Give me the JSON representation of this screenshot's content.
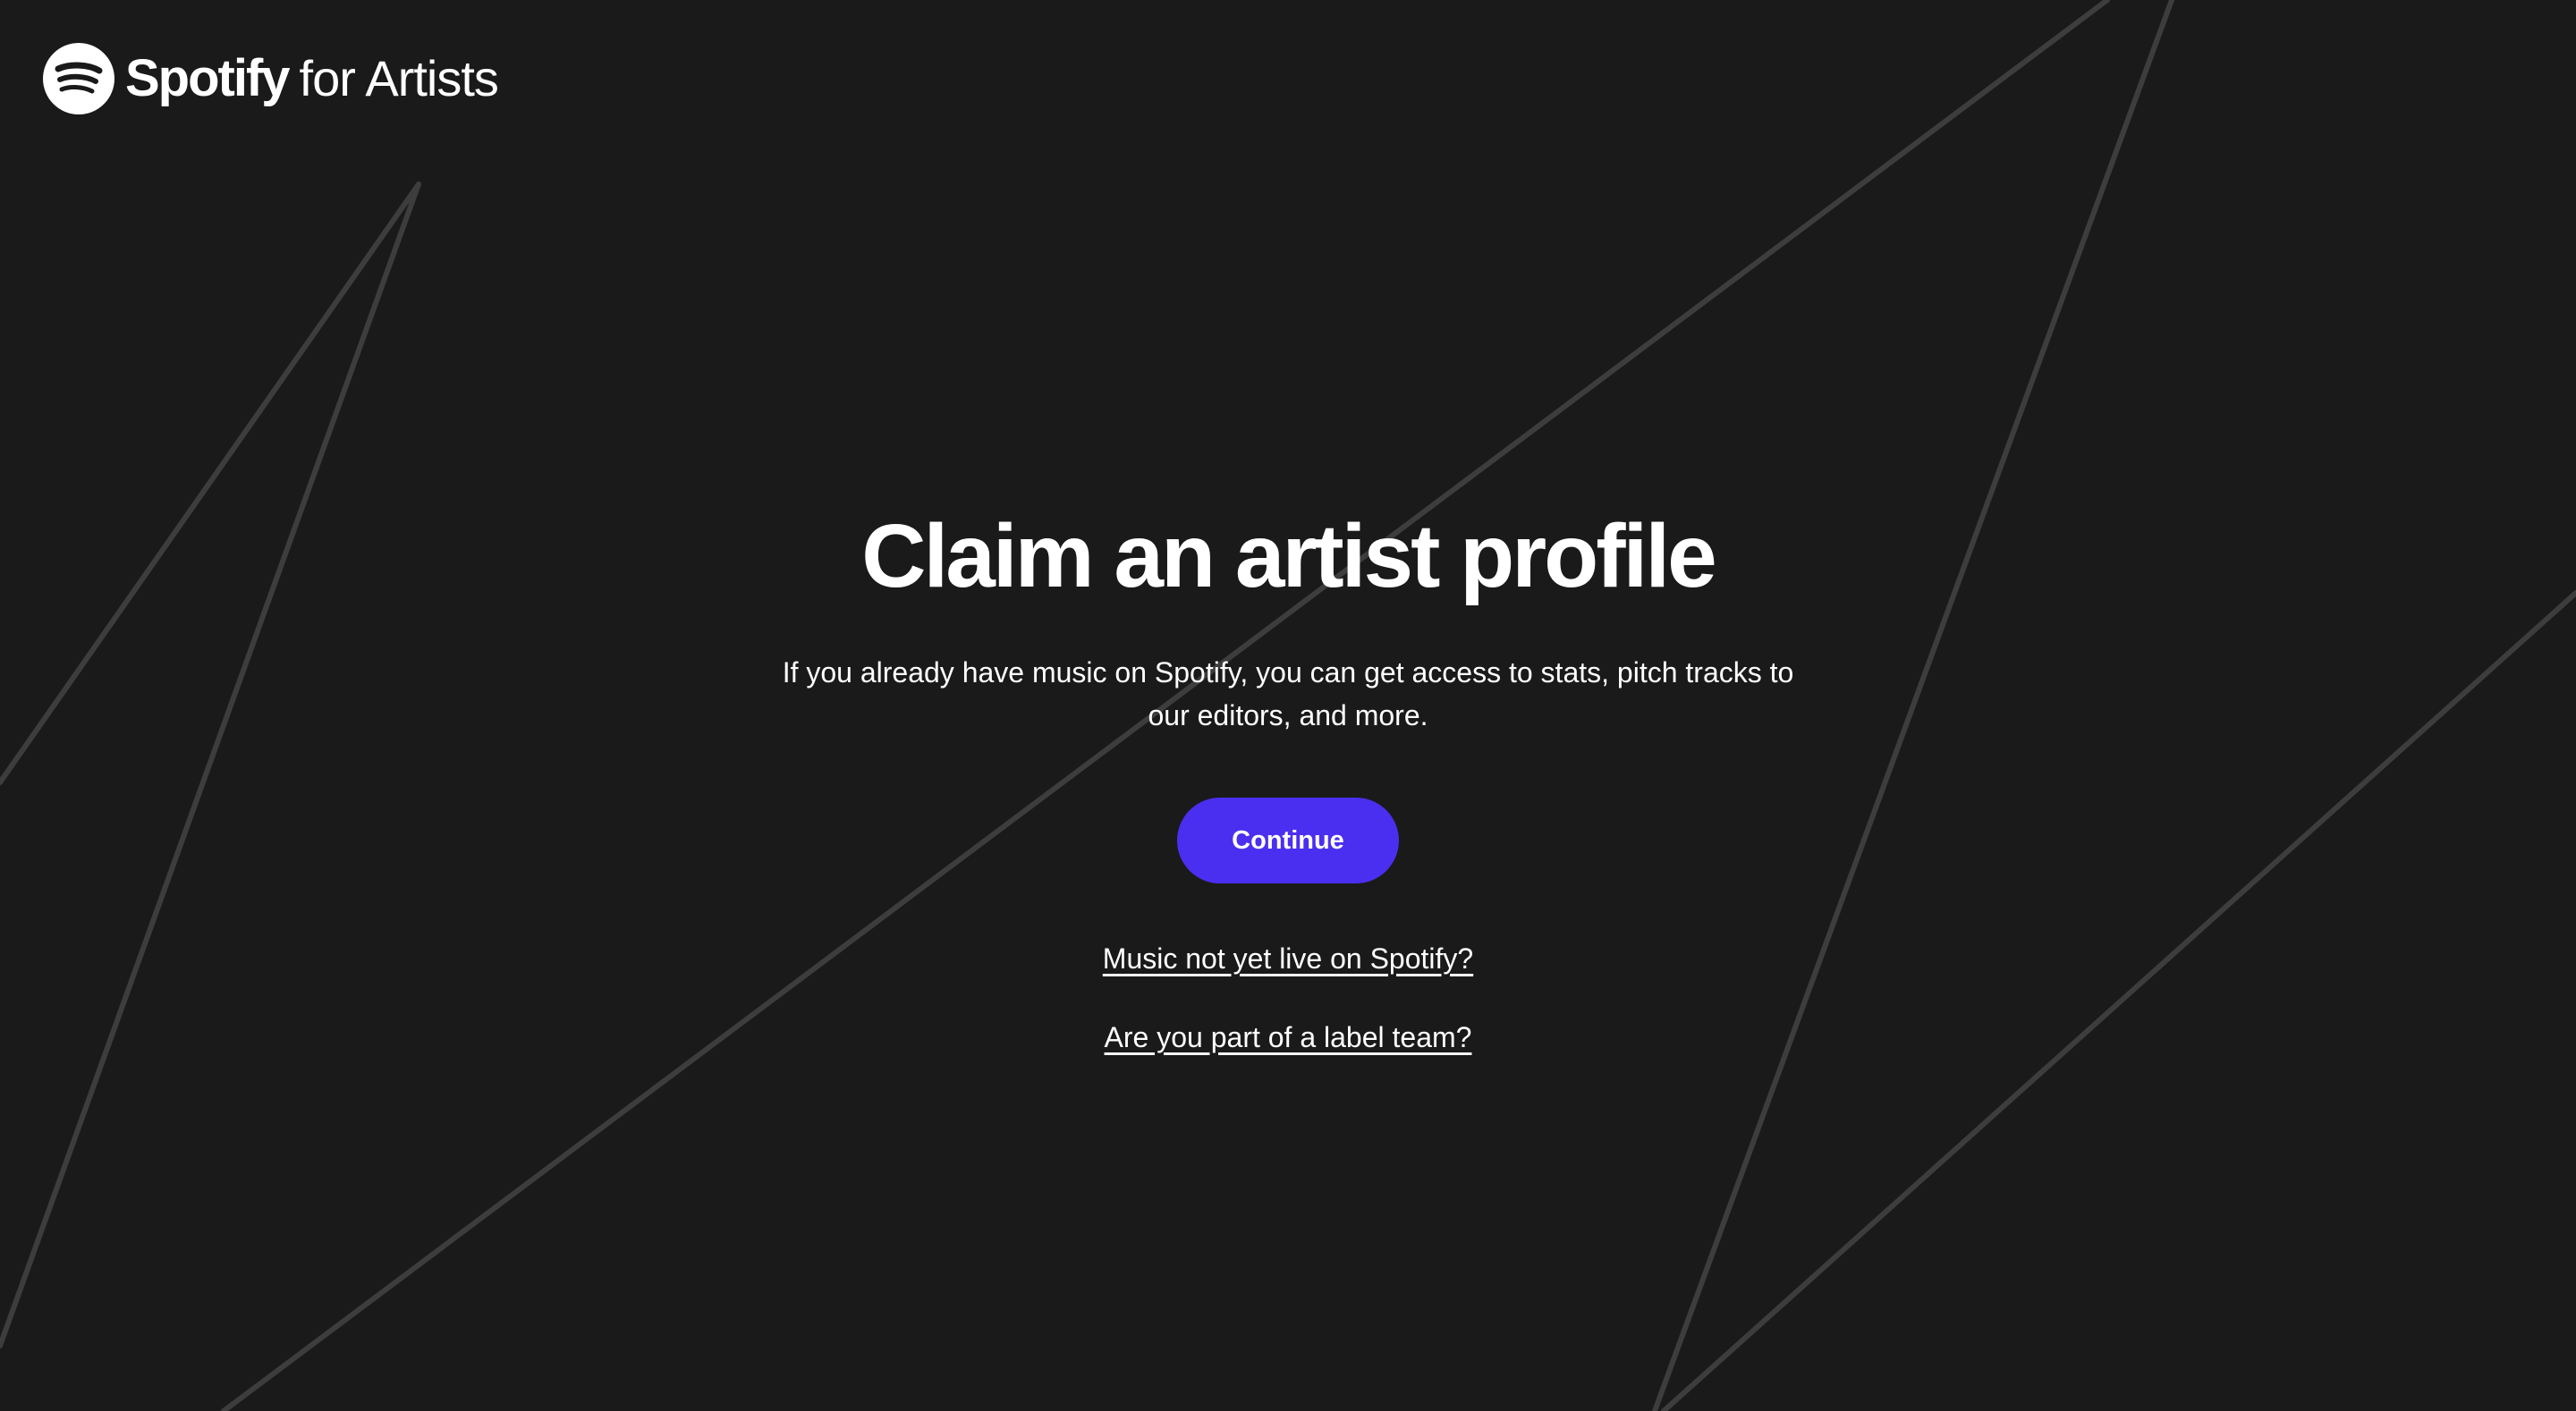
{
  "header": {
    "logo_wordmark": "Spotify",
    "logo_suffix": "for Artists",
    "logo_icon": "spotify-logo-icon"
  },
  "main": {
    "title": "Claim an artist profile",
    "description": "If you already have music on Spotify, you can get access to stats, pitch tracks to our editors, and more.",
    "continue_label": "Continue",
    "link_not_live": "Music not yet live on Spotify?",
    "link_label_team": "Are you part of a label team?"
  },
  "colors": {
    "background": "#1a1a1a",
    "accent": "#4b2ff0",
    "text": "#ffffff",
    "decor_lines": "#3d3d3d"
  }
}
